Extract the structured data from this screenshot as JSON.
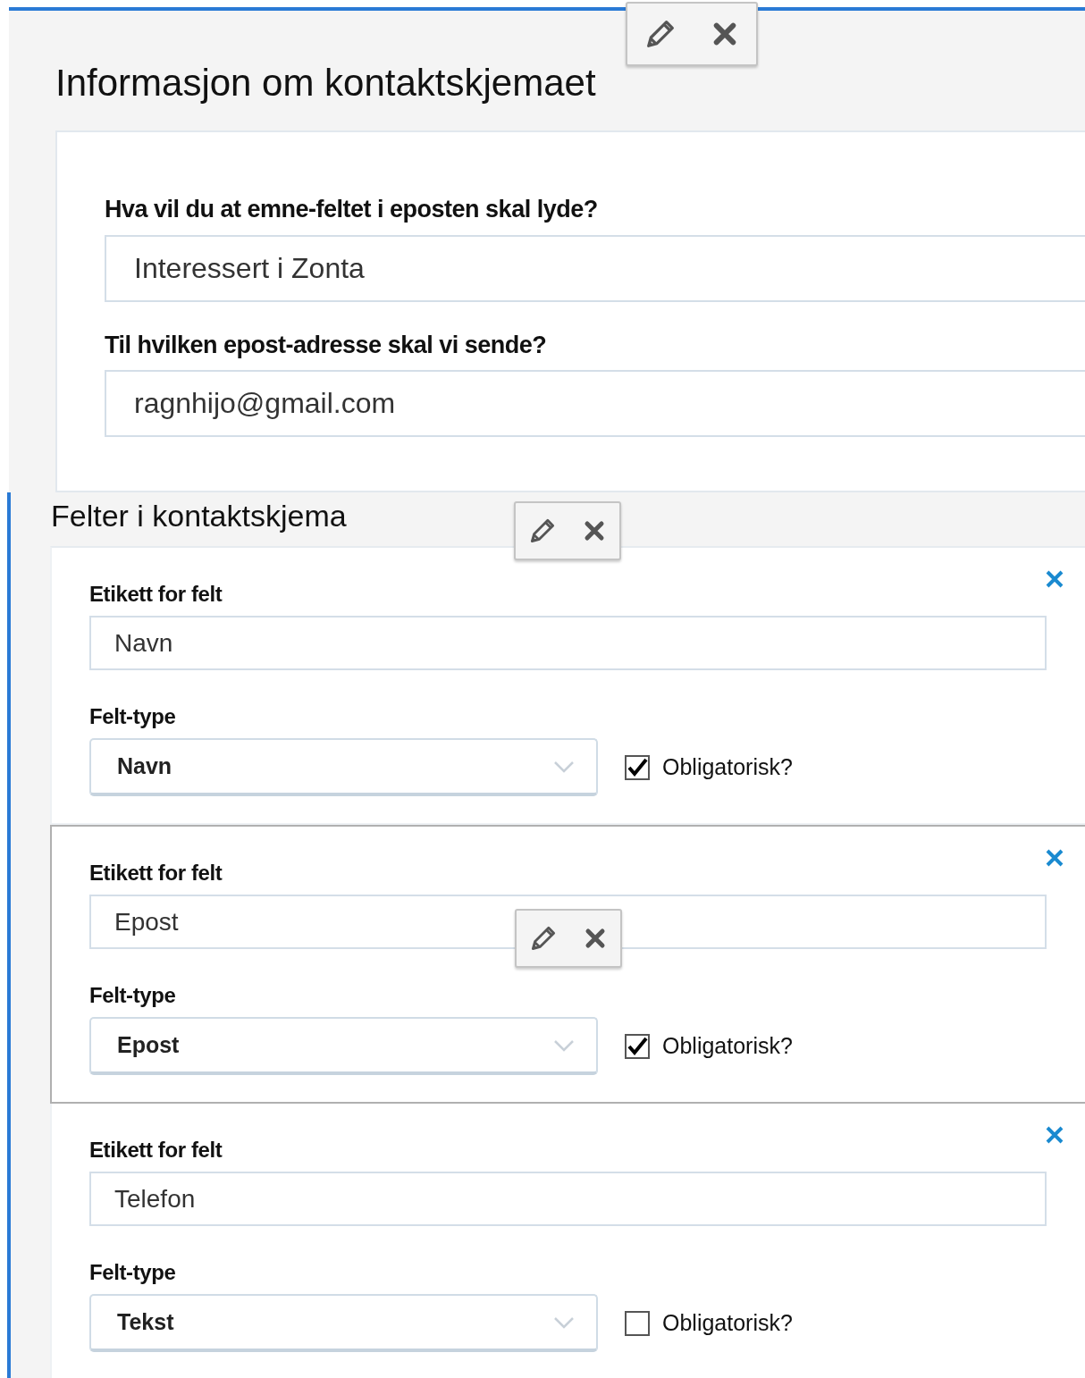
{
  "form_info": {
    "title": "Informasjon om kontaktskjemaet",
    "fields": [
      {
        "label": "Hva vil du at emne-feltet i eposten skal lyde?",
        "value": "Interessert i Zonta"
      },
      {
        "label": "Til hvilken epost-adresse skal vi sende?",
        "value": "ragnhijo@gmail.com"
      }
    ]
  },
  "fields_section": {
    "title": "Felter i kontaktskjema",
    "items": [
      {
        "label_caption": "Etikett for felt",
        "label_value": "Navn",
        "type_caption": "Felt-type",
        "type_value": "Navn",
        "required_label": "Obligatorisk?",
        "required": true,
        "selected": false
      },
      {
        "label_caption": "Etikett for felt",
        "label_value": "Epost",
        "type_caption": "Felt-type",
        "type_value": "Epost",
        "required_label": "Obligatorisk?",
        "required": true,
        "selected": true
      },
      {
        "label_caption": "Etikett for felt",
        "label_value": "Telefon",
        "type_caption": "Felt-type",
        "type_value": "Tekst",
        "required_label": "Obligatorisk?",
        "required": false,
        "selected": false
      }
    ]
  }
}
